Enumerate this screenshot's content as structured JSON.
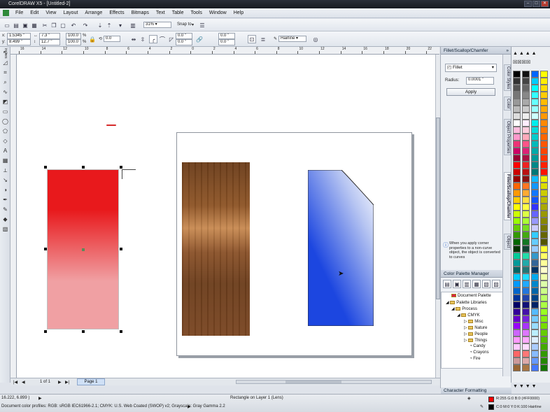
{
  "window": {
    "title": "CorelDRAW X5 - [Untitled-2]"
  },
  "menu": [
    "File",
    "Edit",
    "View",
    "Layout",
    "Arrange",
    "Effects",
    "Bitmaps",
    "Text",
    "Table",
    "Tools",
    "Window",
    "Help"
  ],
  "toolbar": {
    "zoom": "31%",
    "snap_to": "Snap to"
  },
  "property_bar": {
    "x": "1.5345 \"",
    "y": "8.499 \"",
    "width": "7.3 \"",
    "height": "12.7 \"",
    "scale_w": "100.0",
    "scale_h": "100.0",
    "pct": "%",
    "rotation": "0.0",
    "corner_1": "0.0 \"",
    "corner_2": "0.0 \"",
    "corner_3": "0.0 \"",
    "corner_4": "0.0 \"",
    "outline": "Hairline"
  },
  "ruler_h_ticks": [
    "16",
    "14",
    "12",
    "10",
    "8",
    "6",
    "4",
    "2",
    "0",
    "2",
    "4",
    "6",
    "8",
    "10",
    "12",
    "14",
    "16",
    "18",
    "20",
    "22"
  ],
  "ruler_unit": "inches",
  "fillet_docker": {
    "title": "Fillet/Scallop/Chamfer",
    "mode": "Fillet",
    "radius_label": "Radius:",
    "radius_value": "0.0001 \"",
    "apply_label": "Apply",
    "info_text": "When you apply corner properties to a non-curve object, the object is converted to curves"
  },
  "palette_manager": {
    "title": "Color Palette Manager",
    "tree": [
      "Document Palette",
      "Palette Libraries",
      "Process",
      "CMYK",
      "Misc",
      "Nature",
      "People",
      "Things",
      "Candy",
      "Crayons",
      "Fire"
    ]
  },
  "character_formatting": {
    "title": "Character Formatting"
  },
  "vertical_tabs": [
    "Color Styles",
    "Color",
    "Object Properties",
    "Fillet/Scallop/Chamfer",
    "Object"
  ],
  "page_nav": {
    "counter": "1 of 1",
    "page_tab": "Page 1"
  },
  "status": {
    "coords": "16.222, 6.899 )",
    "selection": "Rectangle on Layer 1  (Lens)",
    "profiles": "Document color profiles: RGB: sRGB IEC61966-2.1; CMYK: U.S. Web Coated (SWOP) v2; Grayscale: Gray Gamma 2.2",
    "fill_info": "R:255 G:0 B:0 (#FF0000)",
    "outline_info": "C:0 M:0 Y:0 K:100  Hairline"
  },
  "colors": {
    "accent": "#2b63c9",
    "red_rect_top": "#e8191c",
    "red_rect_bottom": "#f0a0a3",
    "blue_rect": "#1c46e0",
    "fill_swatch": "#ff0000"
  }
}
